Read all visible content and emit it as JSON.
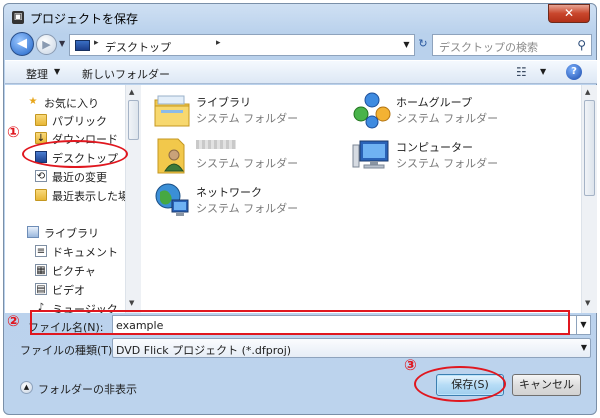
{
  "window": {
    "title": "プロジェクトを保存",
    "close_glyph": "✕",
    "app_icon_glyph": "▣"
  },
  "navbar": {
    "back_glyph": "◀",
    "forward_glyph": "▶",
    "history_glyph": "▼",
    "address_arrow": "▸",
    "address_text": "デスクトップ",
    "address_crumb": "▸",
    "address_dropdown_glyph": "▼",
    "refresh_glyph": "↻",
    "search_placeholder": "デスクトップの検索",
    "search_glyph": "⚲"
  },
  "toolbar": {
    "organize_label": "整理",
    "organize_arrow": "▼",
    "new_folder_label": "新しいフォルダー",
    "views_glyph": "☷",
    "views_arrow": "▼",
    "help_glyph": "?"
  },
  "sidebar": {
    "items": [
      {
        "label": "お気に入り",
        "icon": "star-icon",
        "glyph": "★"
      },
      {
        "label": "パブリック",
        "icon": "folder-icon",
        "glyph": ""
      },
      {
        "label": "ダウンロード",
        "icon": "downloads-folder-icon",
        "glyph": "↓"
      },
      {
        "label": "デスクトップ",
        "icon": "desktop-icon",
        "glyph": ""
      },
      {
        "label": "最近の変更",
        "icon": "recent-places-icon",
        "glyph": "⟲"
      },
      {
        "label": "最近表示した場所",
        "icon": "recent-folder-icon",
        "glyph": ""
      },
      {
        "label": "ライブラリ",
        "icon": "libraries-icon",
        "glyph": ""
      },
      {
        "label": "ドキュメント",
        "icon": "documents-icon",
        "glyph": "≡"
      },
      {
        "label": "ピクチャ",
        "icon": "pictures-icon",
        "glyph": "▦"
      },
      {
        "label": "ビデオ",
        "icon": "videos-icon",
        "glyph": "▤"
      },
      {
        "label": "ミュージック",
        "icon": "music-icon",
        "glyph": "♪"
      }
    ],
    "scroll_up": "▲",
    "scroll_down": "▼"
  },
  "files": {
    "items": [
      {
        "name": "ライブラリ",
        "type": "システム フォルダー",
        "icon": "libraries-icon"
      },
      {
        "name": "ホームグループ",
        "type": "システム フォルダー",
        "icon": "homegroup-icon"
      },
      {
        "name": "",
        "type": "システム フォルダー",
        "icon": "user-folder-icon",
        "name_redacted": true
      },
      {
        "name": "コンピューター",
        "type": "システム フォルダー",
        "icon": "computer-icon"
      },
      {
        "name": "ネットワーク",
        "type": "システム フォルダー",
        "icon": "network-icon"
      }
    ],
    "scroll_up": "▲",
    "scroll_down": "▼"
  },
  "form": {
    "filename_label": "ファイル名(N):",
    "filename_value": "example",
    "filename_dropdown_glyph": "▼",
    "filetype_label": "ファイルの種類(T):",
    "filetype_value": "DVD Flick プロジェクト (*.dfproj)",
    "filetype_arrow": "▼"
  },
  "footer": {
    "hide_folders_label": "フォルダーの非表示",
    "hide_folders_glyph": "▲",
    "save_label": "保存(S)",
    "cancel_label": "キャンセル"
  },
  "annotations": {
    "marker_1": "①",
    "marker_2": "②",
    "marker_3": "③",
    "color": "#e0171f"
  }
}
